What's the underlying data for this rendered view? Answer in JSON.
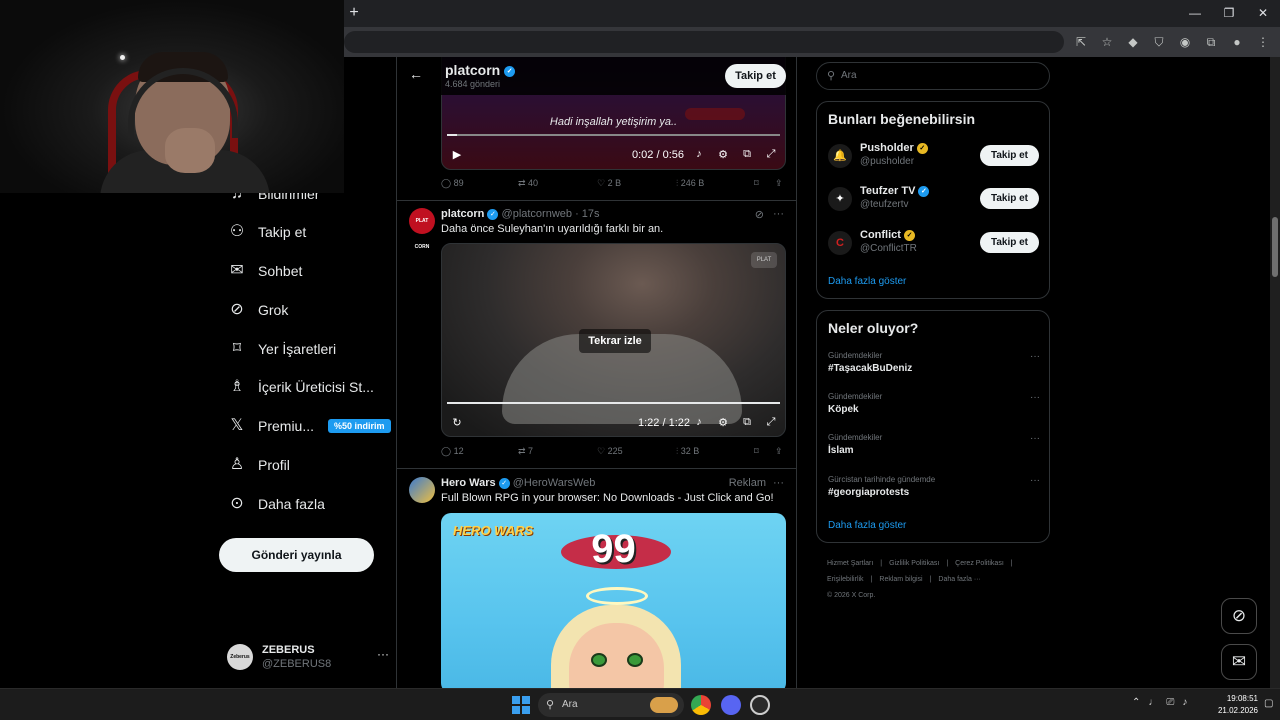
{
  "browser": {
    "new_tab": "+",
    "window_controls": [
      "—",
      "❐",
      "✕"
    ],
    "toolbar_icons": [
      "install-icon",
      "star-icon",
      "extension-icon",
      "shield-icon",
      "extension-icon",
      "puzzle-icon",
      "profile-icon",
      "menu-icon"
    ]
  },
  "sidebar": {
    "items": [
      {
        "icon": "bell-icon",
        "glyph": "♫",
        "label": "Bildirimler"
      },
      {
        "icon": "follow-icon",
        "glyph": "⚇",
        "label": "Takip et"
      },
      {
        "icon": "mail-icon",
        "glyph": "✉",
        "label": "Sohbet"
      },
      {
        "icon": "grok-icon",
        "glyph": "⊘",
        "label": "Grok"
      },
      {
        "icon": "bookmark-icon",
        "glyph": "⌑",
        "label": "Yer İşaretleri"
      },
      {
        "icon": "creator-icon",
        "glyph": "♗",
        "label": "İçerik Üreticisi St..."
      },
      {
        "icon": "x-icon",
        "glyph": "𝕏",
        "label": "Premiu...",
        "badge": "%50 indirim"
      },
      {
        "icon": "person-icon",
        "glyph": "♙",
        "label": "Profil"
      },
      {
        "icon": "more-icon",
        "glyph": "⊙",
        "label": "Daha fazla"
      }
    ],
    "post_button": "Gönderi yayınla",
    "account": {
      "avatar_text": "Zeberus",
      "name": "ZEBERUS",
      "handle": "@ZEBERUS8",
      "more": "···"
    }
  },
  "header": {
    "name": "platcorn",
    "post_count": "4.684 gönderi",
    "follow": "Takip et"
  },
  "feed": {
    "video1": {
      "subtitle": "Hadi inşallah yetişirim ya..",
      "time": "0:02 / 0:56",
      "progress": 0.03,
      "stats": {
        "replies": "89",
        "reposts": "40",
        "likes": "2 B",
        "views": "246 B"
      }
    },
    "tweet2": {
      "name": "platcorn",
      "handle": "@platcornweb",
      "time": "· 17s",
      "text": "Daha önce Suleyhan'ın uyarıldığı farklı bir an.",
      "avatar_text": "PLAT CORN",
      "replay": "Tekrar izle",
      "video_time": "1:22 / 1:22",
      "progress": 1.0,
      "stats": {
        "replies": "12",
        "reposts": "7",
        "likes": "225",
        "views": "32 B"
      }
    },
    "tweet3": {
      "name": "Hero Wars",
      "handle": "@HeroWarsWeb",
      "ad_label": "Reklam",
      "text": "Full Blown RPG in your browser: No Downloads - Just Click and Go!",
      "image_logo": "HERO WARS",
      "image_number": "99"
    }
  },
  "right": {
    "search_placeholder": "Ara",
    "who_to_follow": {
      "title": "Bunları beğenebilirsin",
      "accounts": [
        {
          "name": "Pusholder",
          "handle": "@pusholder",
          "badge": "gold",
          "glyph": "🔔",
          "follow": "Takip et"
        },
        {
          "name": "Teufzer TV",
          "handle": "@teufzertv",
          "badge": "blue",
          "glyph": "✦",
          "follow": "Takip et"
        },
        {
          "name": "Conflict",
          "handle": "@ConflictTR",
          "badge": "gold",
          "glyph": "C",
          "follow": "Takip et"
        }
      ],
      "more": "Daha fazla göster"
    },
    "trends": {
      "title": "Neler oluyor?",
      "items": [
        {
          "category": "Gündemdekiler",
          "name": "#TaşacakBuDeniz"
        },
        {
          "category": "Gündemdekiler",
          "name": "Köpek"
        },
        {
          "category": "Gündemdekiler",
          "name": "İslam"
        },
        {
          "category": "Gürcistan tarihinde gündemde",
          "name": "#georgiaprotests"
        }
      ],
      "more": "Daha fazla göster"
    },
    "footer": {
      "line1": [
        "Hizmet Şartları",
        "|",
        "Gizlilik Politikası",
        "|",
        "Çerez Politikası",
        "|"
      ],
      "line2": [
        "Erişilebilirlik",
        "|",
        "Reklam bilgisi",
        "|",
        "Daha fazla ···"
      ],
      "line3": "© 2026 X Corp."
    }
  },
  "taskbar": {
    "search": "Ara",
    "time": "19:08:51",
    "date": "21.02.2026"
  },
  "colors": {
    "accent": "#1d9bf0",
    "background": "#000000",
    "border": "#2f3336",
    "muted_text": "#71767b"
  }
}
